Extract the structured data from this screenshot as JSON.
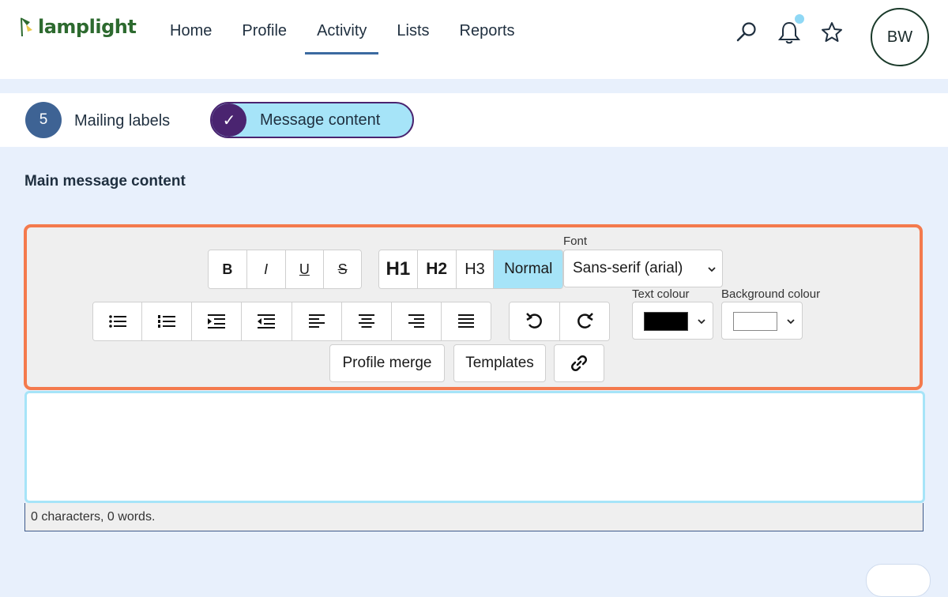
{
  "app": {
    "name": "lamplight"
  },
  "nav": {
    "items": [
      "Home",
      "Profile",
      "Activity",
      "Lists",
      "Reports"
    ],
    "active": "Activity"
  },
  "user": {
    "initials": "BW"
  },
  "icons": {
    "search": "search-icon",
    "bell": "bell-icon",
    "star": "star-icon"
  },
  "steps": {
    "number": "5",
    "mailing_labels": "Mailing labels",
    "check": "✓",
    "message_content": "Message content"
  },
  "editor": {
    "title": "Main message content",
    "format_buttons": [
      "B",
      "I",
      "U",
      "S"
    ],
    "heading_buttons": [
      "H1",
      "H2",
      "H3",
      "Normal"
    ],
    "active_heading": "Normal",
    "font_label": "Font",
    "font_value": "Sans-serif (arial)",
    "text_colour_label": "Text colour",
    "text_colour_value": "#000000",
    "background_colour_label": "Background colour",
    "background_colour_value": "#ffffff",
    "profile_merge": "Profile merge",
    "templates": "Templates",
    "status": "0 characters, 0 words."
  },
  "colors": {
    "accent_orange": "#f47a4d",
    "pill": "#a6e4f8",
    "step": "#3e6394",
    "purple": "#4a2470"
  }
}
